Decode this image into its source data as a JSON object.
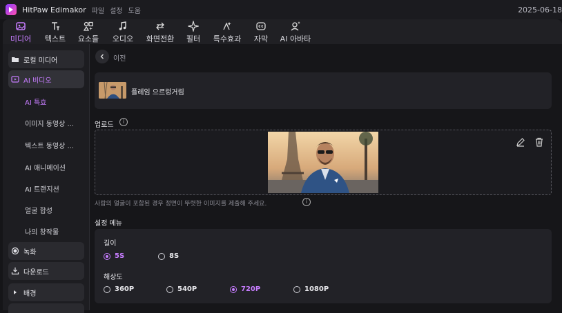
{
  "titlebar": {
    "app_name": "HitPaw Edimakor",
    "menus": [
      "파일",
      "설정",
      "도움"
    ],
    "date": "2025-06-18"
  },
  "toolbar": {
    "tools": [
      {
        "label": "미디어",
        "icon": "media-icon",
        "active": true
      },
      {
        "label": "텍스트",
        "icon": "text-icon"
      },
      {
        "label": "요소들",
        "icon": "elements-icon"
      },
      {
        "label": "오디오",
        "icon": "audio-icon"
      },
      {
        "label": "화면전환",
        "icon": "transition-icon"
      },
      {
        "label": "필터",
        "icon": "filter-icon"
      },
      {
        "label": "특수효과",
        "icon": "effects-icon"
      },
      {
        "label": "자막",
        "icon": "subtitle-icon"
      },
      {
        "label": "AI 아바타",
        "icon": "ai-avatar-icon"
      }
    ]
  },
  "sidebar": {
    "local_media": "로컬 미디어",
    "ai_video": "AI 비디오",
    "sub_items": [
      "AI 특효",
      "이미지 동영상 ...",
      "텍스트 동영상 ...",
      "AI 애니메이션",
      "AI 트랜지션",
      "얼굴 합성",
      "나의 창작물"
    ],
    "record": "녹화",
    "download": "다운로드",
    "background": "배경"
  },
  "main": {
    "back_label": "이전",
    "template_name": "플레임 으르렁거림",
    "upload_label": "업로드",
    "hint": "사람의 얼굴이 포함된 경우 정면이 뚜렷한 이미지를 제출해 주세요.",
    "settings_title": "설정 메뉴",
    "length_label": "길이",
    "length_options": [
      "5S",
      "8S"
    ],
    "length_selected": "5S",
    "resolution_label": "해상도",
    "resolution_options": [
      "360P",
      "540P",
      "720P",
      "1080P"
    ],
    "resolution_selected": "720P"
  },
  "colors": {
    "accent": "#c77dff",
    "background": "#151518",
    "card": "#222227"
  }
}
